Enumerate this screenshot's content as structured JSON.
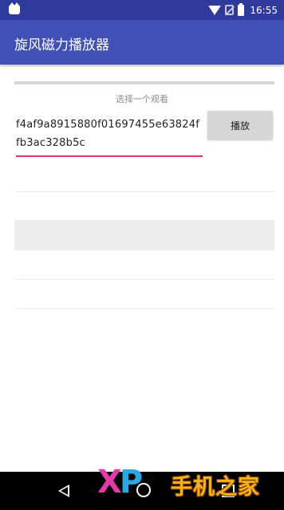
{
  "status_bar": {
    "time": "16:55"
  },
  "app_bar": {
    "title": "旋风磁力播放器"
  },
  "content": {
    "hint": "选择一个观看",
    "magnet_value": "f4af9a8915880f01697455e63824ffb3ac328b5c",
    "play_label": "播放"
  },
  "watermark": {
    "logo": "XP",
    "text": "手机之家"
  },
  "colors": {
    "status_bar": "#2e3a9c",
    "app_bar": "#3f51b5",
    "accent": "#e0336b"
  }
}
